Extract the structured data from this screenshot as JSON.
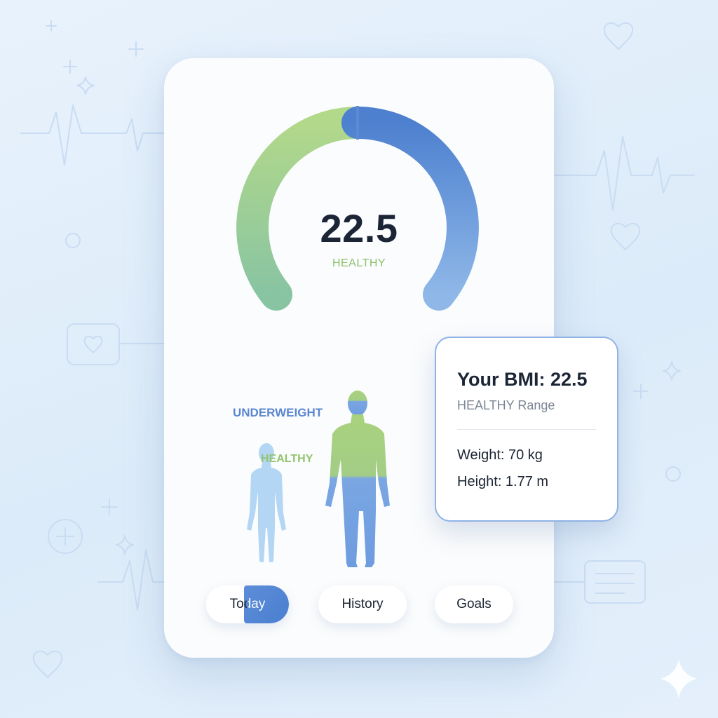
{
  "gauge": {
    "value": "22.5",
    "status": "HEALTHY"
  },
  "figures": {
    "underweight_label": "UNDERWEIGHT",
    "healthy_label": "HEALTHY"
  },
  "nav": {
    "today": "Today",
    "history": "History",
    "goals": "Goals",
    "active": "Today"
  },
  "popover": {
    "title": "Your BMI: 22.5",
    "subtitle": "HEALTHY Range",
    "weight": "Weight: 70 kg",
    "height": "Height: 1.77 m"
  },
  "colors": {
    "accent_blue": "#4a7fd0",
    "healthy_green": "#8cc26a",
    "background": "#e3eefa",
    "card": "#fbfcfd"
  },
  "icons": [
    "heart-icon",
    "plus-icon",
    "sparkle-icon",
    "heartbeat-line-icon",
    "chat-heart-icon",
    "message-icon",
    "circle-icon"
  ]
}
